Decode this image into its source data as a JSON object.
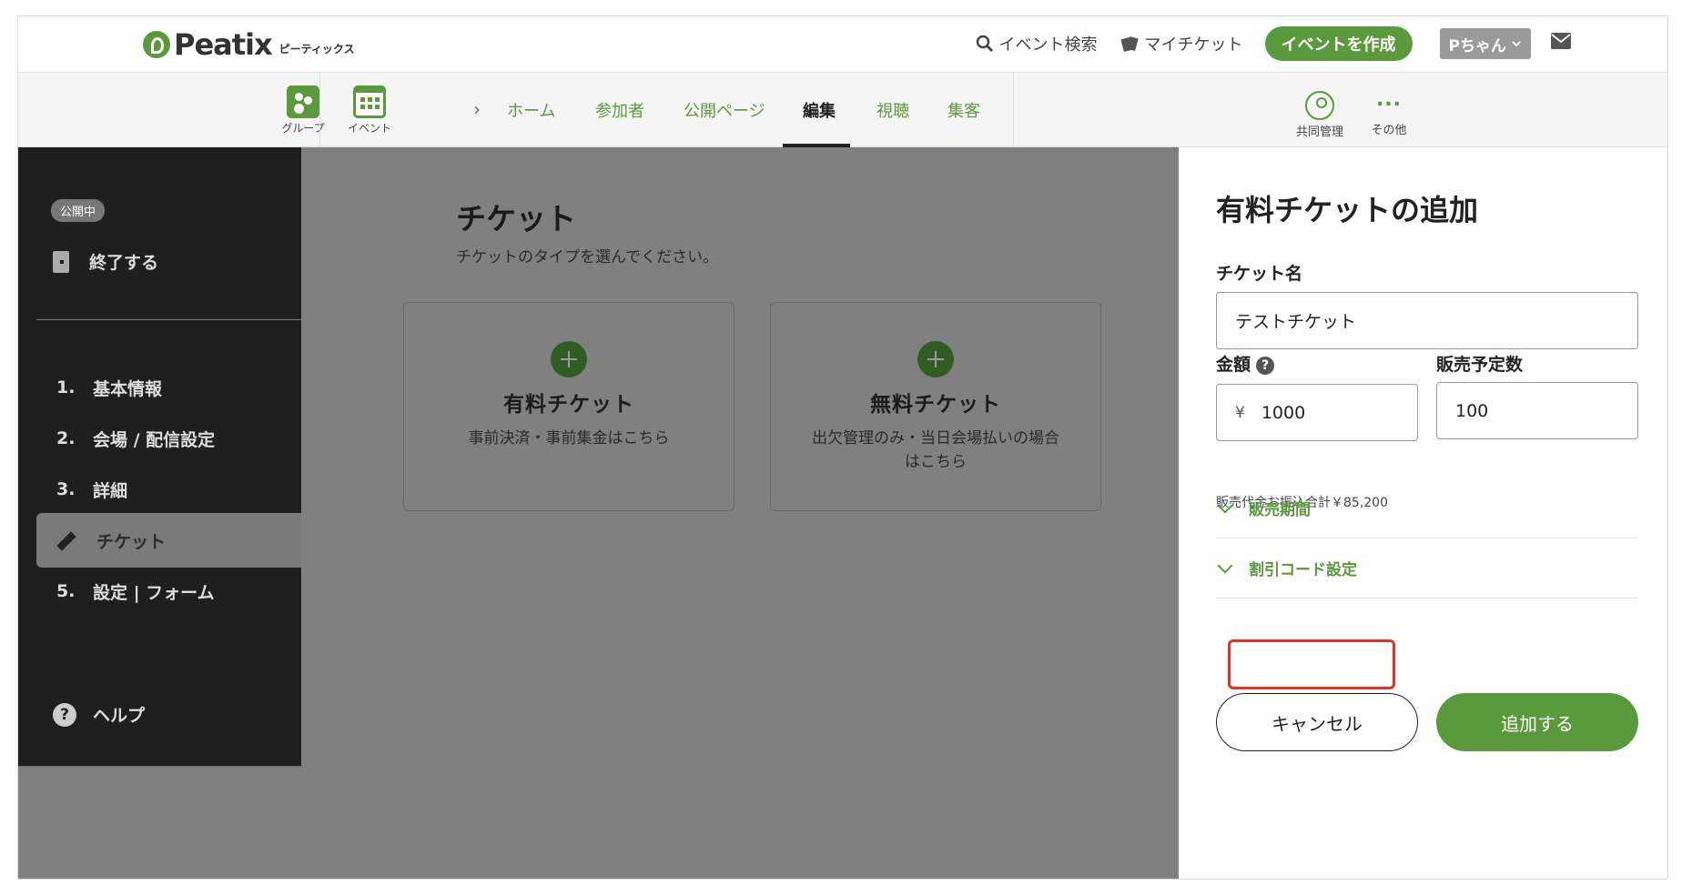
{
  "header": {
    "logo_text": "Peatix",
    "logo_sub": "ピーティックス",
    "search_label": "イベント検索",
    "my_ticket_label": "マイチケット",
    "create_event_label": "イベントを作成",
    "user_label": "Pちゃん"
  },
  "subnav": {
    "group_label": "グループ",
    "event_label": "イベント",
    "tabs": [
      {
        "label": "ホーム"
      },
      {
        "label": "参加者"
      },
      {
        "label": "公開ページ"
      },
      {
        "label": "編集"
      },
      {
        "label": "視聴"
      },
      {
        "label": "集客"
      }
    ],
    "active_tab": "編集",
    "co_manage_label": "共同管理",
    "more_label": "その他",
    "more_dots": "..."
  },
  "sidebar": {
    "status_badge": "公開中",
    "end_label": "終了する",
    "steps": [
      {
        "num": "1.",
        "label": "基本情報"
      },
      {
        "num": "2.",
        "label": "会場 / 配信設定"
      },
      {
        "num": "3.",
        "label": "詳細"
      },
      {
        "num": "",
        "label": "チケット"
      },
      {
        "num": "5.",
        "label": "設定 | フォーム"
      }
    ],
    "help_label": "ヘルプ",
    "help_glyph": "?"
  },
  "main": {
    "title": "チケット",
    "subtitle": "チケットのタイプを選んでください。",
    "cards": [
      {
        "title": "有料チケット",
        "desc": "事前決済・事前集金はこちら"
      },
      {
        "title": "無料チケット",
        "desc": "出欠管理のみ・当日会場払いの場合はこちら"
      }
    ]
  },
  "panel": {
    "title": "有料チケットの追加",
    "ticket_name_label": "チケット名",
    "ticket_name_value": "テストチケット",
    "price_label": "金額",
    "price_help": "?",
    "currency_symbol": "¥",
    "price_value": "1000",
    "quantity_label": "販売予定数",
    "quantity_value": "100",
    "total_text": "販売代金お振込合計￥85,200",
    "sales_period_label": "販売期間",
    "discount_code_label": "割引コード設定",
    "cancel_label": "キャンセル",
    "add_label": "追加する"
  },
  "colors": {
    "brand_green": "#5a9a3c",
    "highlight_red": "#e0322b",
    "sidebar_bg": "#1f1f1f",
    "overlay_gray": "#808080"
  }
}
